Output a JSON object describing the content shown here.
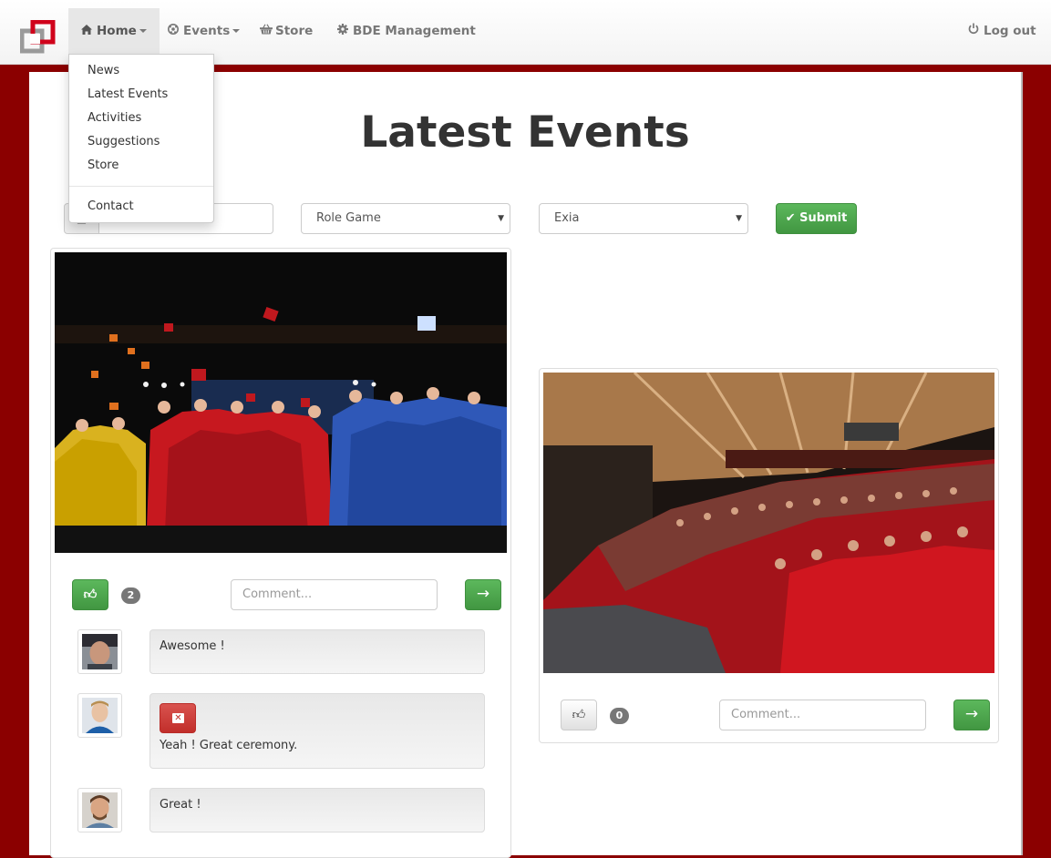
{
  "navbar": {
    "items": [
      {
        "label": "Home",
        "icon": "home-icon"
      },
      {
        "label": "Events",
        "icon": "soccer-ball-icon"
      },
      {
        "label": "Store",
        "icon": "basket-icon"
      },
      {
        "label": "BDE Management",
        "icon": "gear-icon"
      }
    ],
    "logout_label": "Log out"
  },
  "dropdown": {
    "items": [
      "News",
      "Latest Events",
      "Activities",
      "Suggestions",
      "Store"
    ],
    "contact": "Contact"
  },
  "page_title": "Latest Events",
  "filters": {
    "category_selected": "Role Game",
    "campus_selected": "Exia",
    "submit_label": "Submit"
  },
  "events": [
    {
      "likes": "2",
      "comment_placeholder": "Comment...",
      "comments": [
        {
          "text": "Awesome !"
        },
        {
          "text": "Yeah ! Great ceremony.",
          "deletable": true
        },
        {
          "text": "Great !"
        }
      ]
    },
    {
      "likes": "0",
      "comment_placeholder": "Comment..."
    }
  ],
  "colors": {
    "background": "#8b0000",
    "success": "#5cb85c",
    "danger": "#d9534f"
  }
}
